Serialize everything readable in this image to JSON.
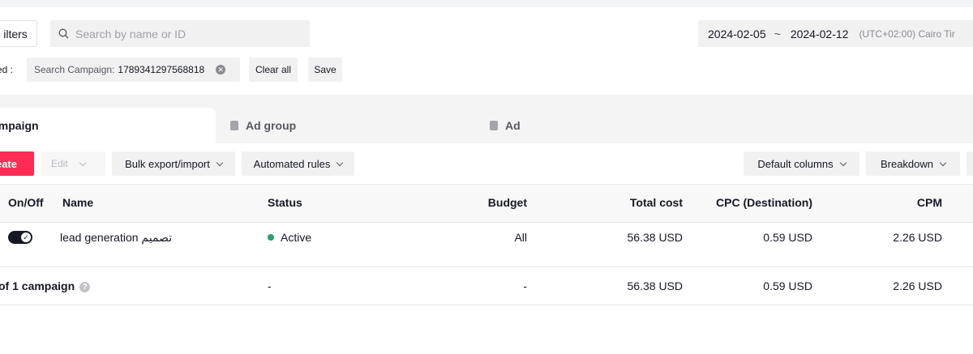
{
  "filters": {
    "filters_label": "ilters"
  },
  "search": {
    "placeholder": "Search by name or ID"
  },
  "date_range": {
    "start": "2024-02-05",
    "separator": "~",
    "end": "2024-02-12",
    "timezone": "(UTC+02:00) Cairo Tir"
  },
  "applied": {
    "label": "ed :",
    "chip_key": "Search Campaign:",
    "chip_value": "1789341297568818",
    "clear_all": "Clear all",
    "save": "Save"
  },
  "tabs": {
    "campaign": "ampaign",
    "ad_group": "Ad group",
    "ad": "Ad"
  },
  "toolbar": {
    "create": "eate",
    "edit": "Edit",
    "bulk": "Bulk export/import",
    "automated": "Automated rules",
    "default_columns": "Default columns",
    "breakdown": "Breakdown"
  },
  "table": {
    "headers": {
      "onoff": "On/Off",
      "name": "Name",
      "status": "Status",
      "budget": "Budget",
      "total_cost": "Total cost",
      "cpc": "CPC (Destination)",
      "cpm": "CPM"
    },
    "rows": [
      {
        "name": "lead generation تصميم",
        "status": "Active",
        "budget": "All",
        "total_cost": "56.38 USD",
        "cpc": "0.59 USD",
        "cpm": "2.26 USD"
      }
    ],
    "total": {
      "label": "of 1 campaign",
      "status": "-",
      "budget": "-",
      "total_cost": "56.38 USD",
      "cpc": "0.59 USD",
      "cpm": "2.26 USD"
    }
  },
  "colors": {
    "primary": "#fe2c55",
    "active": "#28a06b"
  }
}
